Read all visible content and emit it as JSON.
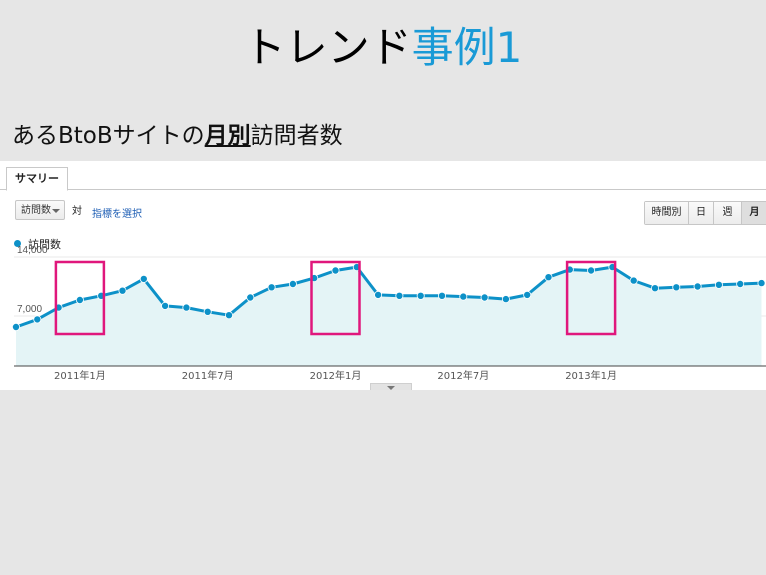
{
  "slide": {
    "title_main": "トレンド",
    "title_accent": "事例1",
    "subtitle_pre": "あるBtoBサイトの",
    "subtitle_em": "月別",
    "subtitle_post": "訪問者数"
  },
  "panel": {
    "tab_label": "サマリー",
    "metric_select": "訪問数",
    "vs_label": "対",
    "compare_link": "指標を選択",
    "periods": [
      "時間別",
      "日",
      "週",
      "月"
    ],
    "active_period": "月",
    "legend_label": "訪問数"
  },
  "colors": {
    "line": "#0d91c8",
    "fill": "#e4f4f6",
    "highlight_box": "#e0177c",
    "title_accent": "#1a9ad6"
  },
  "chart_data": {
    "type": "line",
    "x_start": "2010-10",
    "x_end": "2013-09",
    "x": [
      "2010-10",
      "2010-11",
      "2010-12",
      "2011-01",
      "2011-02",
      "2011-03",
      "2011-04",
      "2011-05",
      "2011-06",
      "2011-07",
      "2011-08",
      "2011-09",
      "2011-10",
      "2011-11",
      "2011-12",
      "2012-01",
      "2012-02",
      "2012-03",
      "2012-04",
      "2012-05",
      "2012-06",
      "2012-07",
      "2012-08",
      "2012-09",
      "2012-10",
      "2012-11",
      "2012-12",
      "2013-01",
      "2013-02",
      "2013-03",
      "2013-04",
      "2013-05",
      "2013-06",
      "2013-07",
      "2013-08",
      "2013-09"
    ],
    "series": [
      {
        "name": "訪問数",
        "values": [
          5700,
          6600,
          8000,
          8900,
          9400,
          10000,
          11400,
          8200,
          8000,
          7500,
          7100,
          9200,
          10400,
          10800,
          11500,
          12400,
          12800,
          9500,
          9400,
          9400,
          9400,
          9300,
          9200,
          9000,
          9500,
          11600,
          12500,
          12400,
          12800,
          11200,
          10300,
          10400,
          10500,
          10700,
          10800,
          10900
        ]
      }
    ],
    "y_ticks": [
      "14,000",
      "7,000"
    ],
    "y_tick_values": [
      14000,
      7000
    ],
    "x_ticks": [
      "2011年1月",
      "2011年7月",
      "2012年1月",
      "2012年7月",
      "2013年1月"
    ],
    "x_tick_months": [
      "2011-01",
      "2011-07",
      "2012-01",
      "2012-07",
      "2013-01"
    ],
    "highlight_months": [
      "2011-01",
      "2012-01",
      "2013-01"
    ],
    "ylim": [
      0,
      14000
    ],
    "grid": true,
    "legend": "top-left"
  }
}
